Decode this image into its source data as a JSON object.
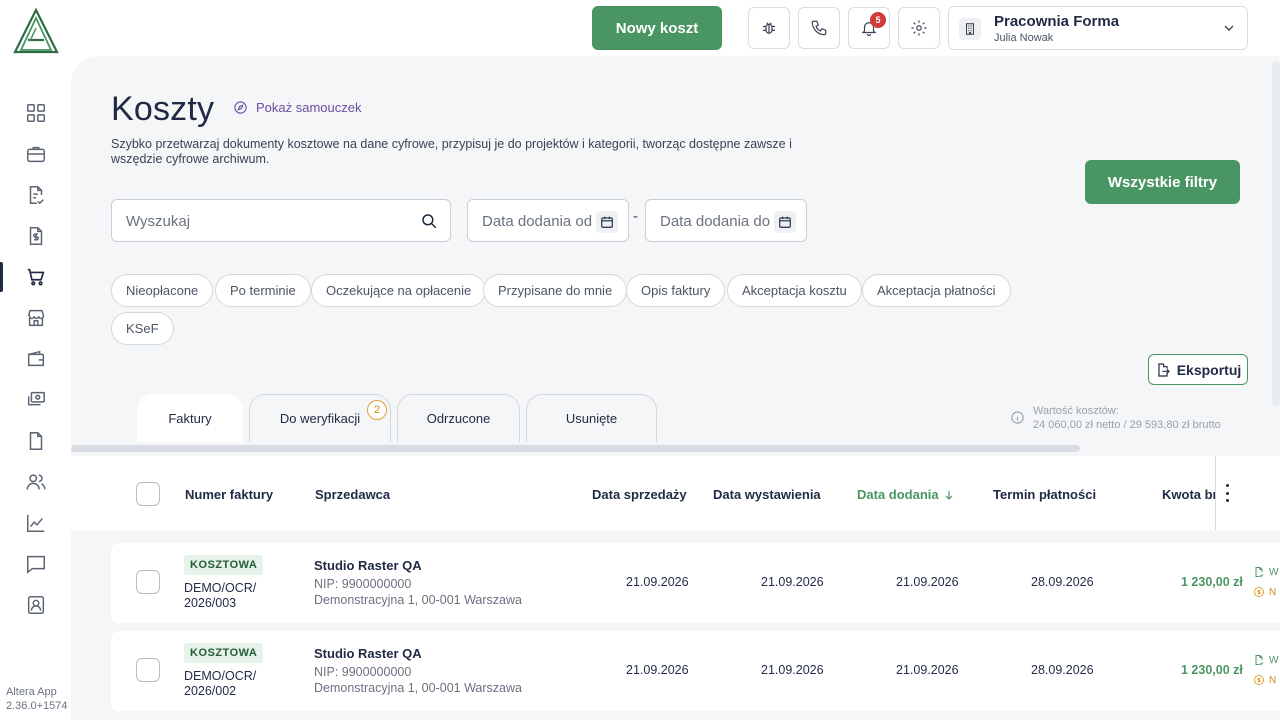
{
  "app": {
    "name": "Altera App",
    "version": "2.36.0+1574"
  },
  "topbar": {
    "new_cost_label": "Nowy koszt",
    "notifications_count": "5",
    "company_name": "Pracownia Forma",
    "user_name": "Julia Nowak"
  },
  "sidebar": {
    "items": [
      {
        "icon": "dashboard-grid-icon"
      },
      {
        "icon": "briefcase-icon"
      },
      {
        "icon": "document-check-icon"
      },
      {
        "icon": "invoice-dollar-icon"
      },
      {
        "icon": "shopping-cart-icon",
        "active": true
      },
      {
        "icon": "store-icon"
      },
      {
        "icon": "wallet-icon"
      },
      {
        "icon": "cash-stack-icon"
      },
      {
        "icon": "file-icon"
      },
      {
        "icon": "users-icon"
      },
      {
        "icon": "chart-line-icon"
      },
      {
        "icon": "chat-icon"
      },
      {
        "icon": "contact-card-icon"
      }
    ]
  },
  "page": {
    "title": "Koszty",
    "tutorial_label": "Pokaż samouczek",
    "description": "Szybko przetwarzaj dokumenty kosztowe na dane cyfrowe, przypisuj je do projektów i kategorii, tworząc dostępne zawsze i wszędzie cyfrowe archiwum.",
    "all_filters_label": "Wszystkie filtry",
    "export_label": "Eksportuj"
  },
  "filters": {
    "search_placeholder": "Wyszukaj",
    "date_from_placeholder": "Data dodania od",
    "date_to_placeholder": "Data dodania do",
    "date_separator": "-",
    "chips": [
      "Nieopłacone",
      "Po terminie",
      "Oczekujące na opłacenie",
      "Przypisane do mnie",
      "Opis faktury",
      "Akceptacja kosztu",
      "Akceptacja płatności",
      "KSeF"
    ]
  },
  "tabs": [
    {
      "label": "Faktury",
      "active": true
    },
    {
      "label": "Do weryfikacji",
      "badge": "2"
    },
    {
      "label": "Odrzucone"
    },
    {
      "label": "Usunięte"
    }
  ],
  "costs_summary": {
    "label": "Wartość kosztów:",
    "value": "24 060,00 zł netto / 29 593,80 zł brutto"
  },
  "table": {
    "columns": {
      "number": "Numer faktury",
      "seller": "Sprzedawca",
      "sale_date": "Data sprzedaży",
      "issue_date": "Data wystawienia",
      "added_date": "Data dodania",
      "due_date": "Termin płatności",
      "amount": "Kwota br"
    },
    "rows": [
      {
        "badge": "KOSZTOWA",
        "number": "DEMO/OCR/ 2026/003",
        "seller": "Studio Raster QA",
        "nip": "NIP: 9900000000",
        "address": "Demonstracyjna 1, 00-001 Warszawa",
        "sale_date": "21.09.2026",
        "issue_date": "21.09.2026",
        "added_date": "21.09.2026",
        "due_date": "28.09.2026",
        "amount": "1 230,00 zł",
        "status1": "W",
        "status2": "N"
      },
      {
        "badge": "KOSZTOWA",
        "number": "DEMO/OCR/ 2026/002",
        "seller": "Studio Raster QA",
        "nip": "NIP: 9900000000",
        "address": "Demonstracyjna 1, 00-001 Warszawa",
        "sale_date": "21.09.2026",
        "issue_date": "21.09.2026",
        "added_date": "21.09.2026",
        "due_date": "28.09.2026",
        "amount": "1 230,00 zł",
        "status1": "W",
        "status2": "N"
      }
    ]
  },
  "colors": {
    "accent": "#4a9663",
    "text": "#1f2a44",
    "panel": "#f4f6f8",
    "badge_bg": "#e7f3ea",
    "warning": "#e0a134",
    "danger": "#d23b3b"
  }
}
